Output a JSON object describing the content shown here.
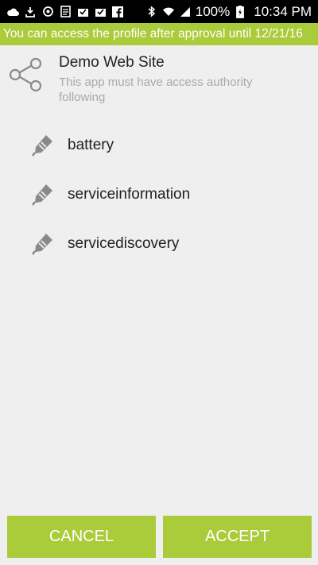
{
  "status_bar": {
    "left_icons": [
      "cloud-icon",
      "download-icon",
      "sync-icon",
      "notes-icon",
      "mail-check-icon",
      "mail-check-icon",
      "facebook-icon"
    ],
    "right_icons": [
      "bluetooth-icon",
      "wifi-icon",
      "signal-icon",
      "battery-charging-icon"
    ],
    "battery_percent": "100%",
    "time": "10:34 PM"
  },
  "banner": {
    "text": "You can access the profile after approval until 12/21/16",
    "color": "#aacb3a"
  },
  "header": {
    "icon": "share-icon",
    "app_name": "Demo Web Site",
    "description": "This app must have access authority following"
  },
  "permissions": [
    {
      "icon": "tag-icon",
      "label": "battery"
    },
    {
      "icon": "tag-icon",
      "label": "serviceinformation"
    },
    {
      "icon": "tag-icon",
      "label": "servicediscovery"
    }
  ],
  "buttons": {
    "cancel_label": "CANCEL",
    "accept_label": "ACCEPT",
    "color": "#aacb3a"
  }
}
